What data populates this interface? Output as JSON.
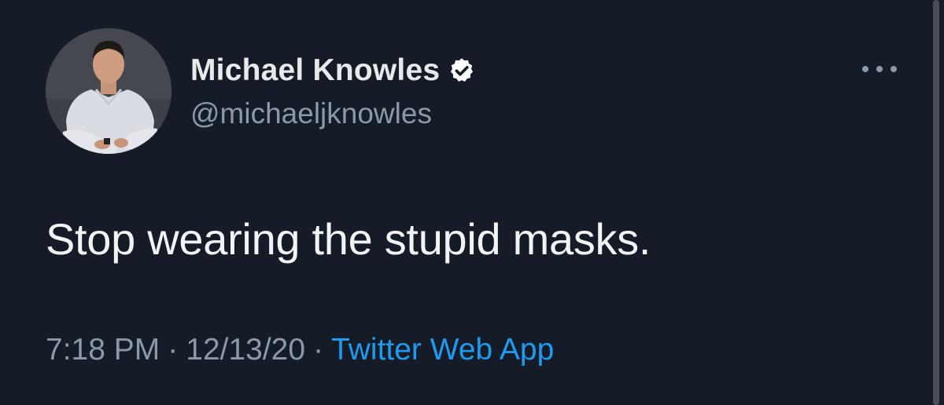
{
  "author": {
    "display_name": "Michael Knowles",
    "handle": "@michaeljknowles",
    "verified": true,
    "avatar_icon": "profile-photo"
  },
  "tweet": {
    "text": "Stop wearing the stupid masks."
  },
  "meta": {
    "time": "7:18 PM",
    "separator": "·",
    "date": "12/13/20",
    "source": "Twitter Web App"
  },
  "icons": {
    "more": "more-horizontal-icon",
    "verified": "verified-badge-icon"
  },
  "colors": {
    "background": "#151c27",
    "text_primary": "#e7e9ea",
    "text_secondary": "#8b98a5",
    "accent": "#1d9bf0"
  }
}
